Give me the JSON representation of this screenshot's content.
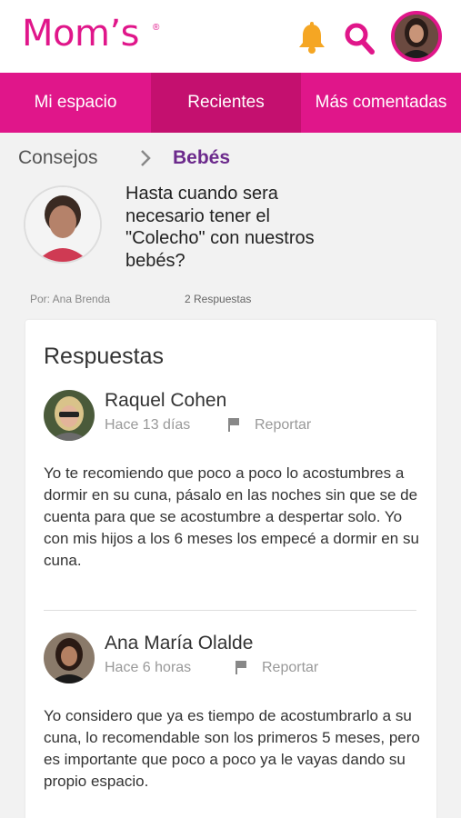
{
  "header": {
    "logo": "Mom’s",
    "logo_mark": "®",
    "notifications_icon": "bell-icon",
    "search_icon": "search-icon",
    "accent": "#e0168a"
  },
  "tabs": [
    {
      "label": "Mi espacio"
    },
    {
      "label": "Recientes",
      "selected": true
    },
    {
      "label": "Más comentadas"
    }
  ],
  "breadcrumb": {
    "parent": "Consejos",
    "current": "Bebés"
  },
  "question": {
    "title": "Hasta cuando sera necesario tener el \"Colecho\" con nuestros bebés?",
    "author": "Por: Ana Brenda",
    "answers_count": "2 Respuestas"
  },
  "answers_section": {
    "title": "Respuestas",
    "items": [
      {
        "name": "Raquel Cohen",
        "time": "Hace 13 días",
        "report_label": "Reportar",
        "text": "Yo te recomiendo que poco a poco lo acostumbres a dormir en su cuna, pásalo en las noches sin que se de cuenta para que se acostumbre a despertar solo. Yo con mis hijos a los 6 meses los empecé a dormir en su cuna."
      },
      {
        "name": "Ana María Olalde",
        "time": "Hace 6 horas",
        "report_label": "Reportar",
        "text": "Yo considero que ya es tiempo de acostumbrarlo a su cuna, lo recomendable son los primeros 5 meses, pero es importante que poco a poco ya le vayas dando su propio espacio."
      }
    ]
  }
}
